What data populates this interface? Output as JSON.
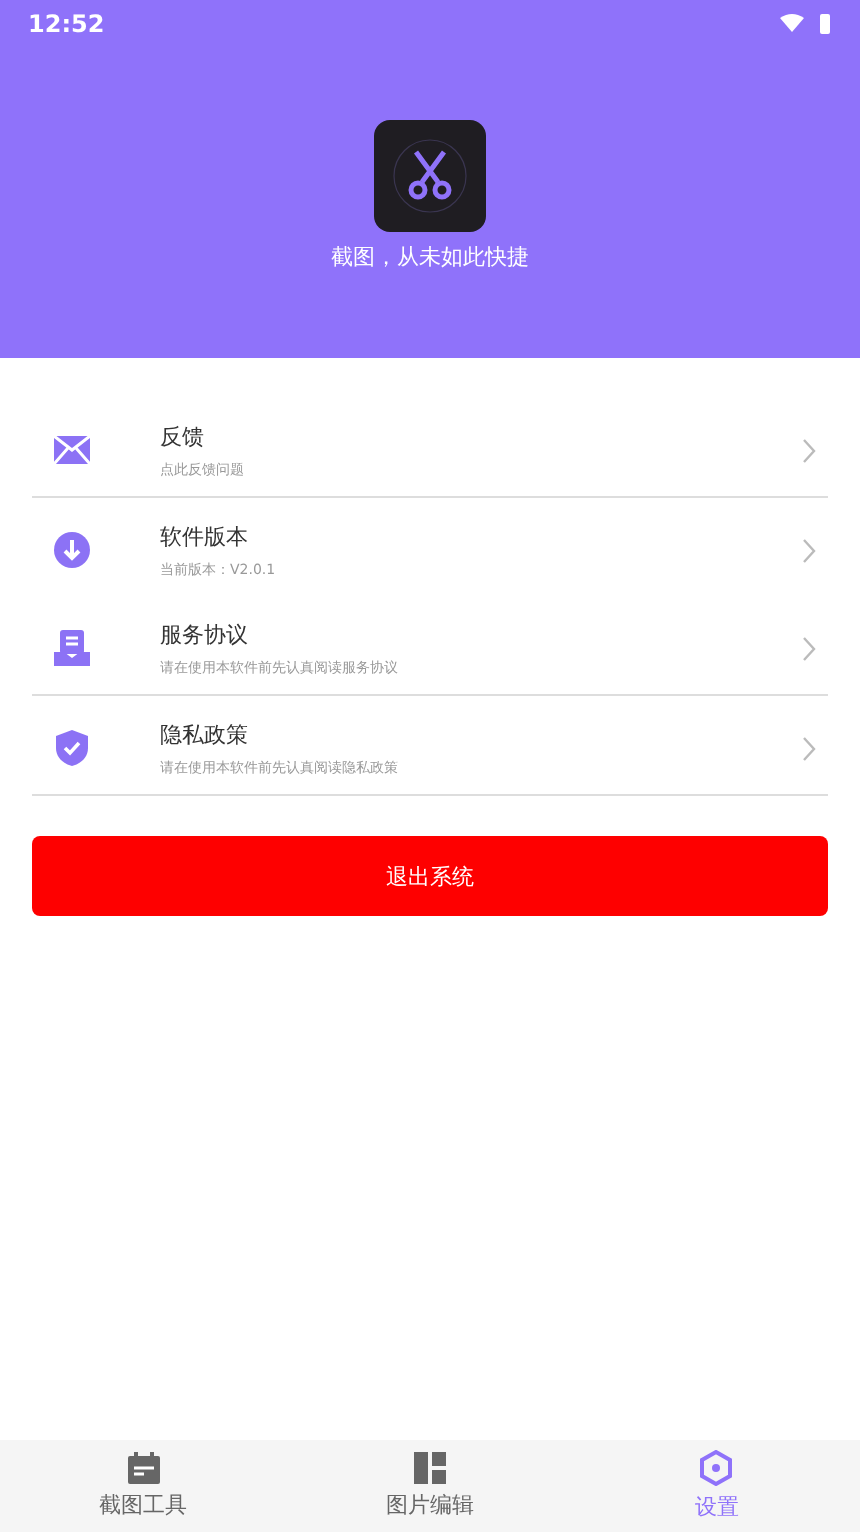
{
  "status_bar": {
    "time": "12:52"
  },
  "header": {
    "tagline": "截图，从未如此快捷"
  },
  "settings": [
    {
      "title": "反馈",
      "subtitle": "点此反馈问题",
      "divider": true
    },
    {
      "title": "软件版本",
      "subtitle": "当前版本：V2.0.1",
      "divider": false
    },
    {
      "title": "服务协议",
      "subtitle": "请在使用本软件前先认真阅读服务协议",
      "divider": true
    },
    {
      "title": "隐私政策",
      "subtitle": "请在使用本软件前先认真阅读隐私政策",
      "divider": true
    }
  ],
  "exit_button": {
    "label": "退出系统"
  },
  "tabs": [
    {
      "label": "截图工具",
      "selected": false
    },
    {
      "label": "图片编辑",
      "selected": false
    },
    {
      "label": "设置",
      "selected": true
    }
  ]
}
